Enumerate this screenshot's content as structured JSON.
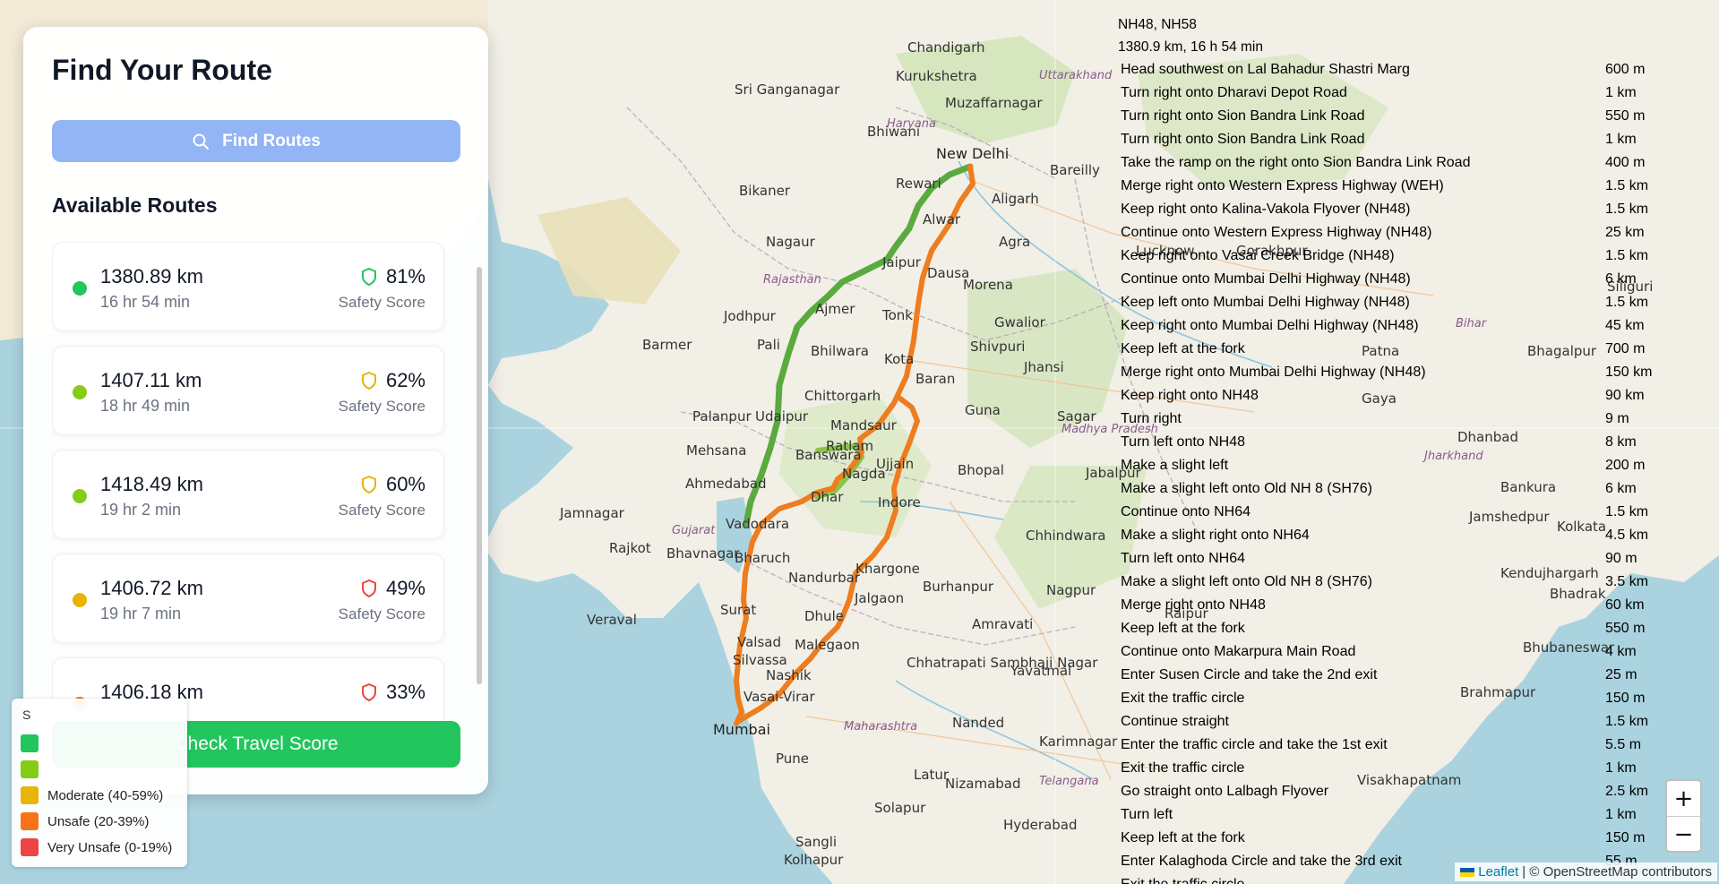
{
  "panel": {
    "title": "Find Your Route",
    "find_button": "Find Routes",
    "routes_heading": "Available Routes",
    "check_button": "Check Travel Score",
    "routes": [
      {
        "distance": "1380.89 km",
        "time": "16 hr 54 min",
        "score": "81%",
        "score_label": "Safety Score",
        "color": "#22c55e",
        "shield_color": "#22c55e"
      },
      {
        "distance": "1407.11 km",
        "time": "18 hr 49 min",
        "score": "62%",
        "score_label": "Safety Score",
        "color": "#84cc16",
        "shield_color": "#eab308"
      },
      {
        "distance": "1418.49 km",
        "time": "19 hr 2 min",
        "score": "60%",
        "score_label": "Safety Score",
        "color": "#84cc16",
        "shield_color": "#eab308"
      },
      {
        "distance": "1406.72 km",
        "time": "19 hr 7 min",
        "score": "49%",
        "score_label": "Safety Score",
        "color": "#eab308",
        "shield_color": "#ef4444"
      },
      {
        "distance": "1406.18 km",
        "time": "",
        "score": "33%",
        "score_label": "",
        "color": "#f97316",
        "shield_color": "#ef4444"
      }
    ]
  },
  "legend": {
    "title": "S",
    "items": [
      {
        "label": "",
        "color": "#22c55e"
      },
      {
        "label": "",
        "color": "#84cc16"
      },
      {
        "label": "Moderate (40-59%)",
        "color": "#eab308"
      },
      {
        "label": "Unsafe (20-39%)",
        "color": "#f97316"
      },
      {
        "label": "Very Unsafe (0-19%)",
        "color": "#ef4444"
      }
    ]
  },
  "directions": {
    "route_name": "NH48, NH58",
    "summary": "1380.9 km, 16 h 54 min",
    "steps": [
      {
        "text": "Head southwest on Lal Bahadur Shastri Marg",
        "distance": "600 m"
      },
      {
        "text": "Turn right onto Dharavi Depot Road",
        "distance": "1 km"
      },
      {
        "text": "Turn right onto Sion Bandra Link Road",
        "distance": "550 m"
      },
      {
        "text": "Turn right onto Sion Bandra Link Road",
        "distance": "1 km"
      },
      {
        "text": "Take the ramp on the right onto Sion Bandra Link Road",
        "distance": "400 m"
      },
      {
        "text": "Merge right onto Western Express Highway (WEH)",
        "distance": "1.5 km"
      },
      {
        "text": "Keep right onto Kalina-Vakola Flyover (NH48)",
        "distance": "1.5 km"
      },
      {
        "text": "Continue onto Western Express Highway (NH48)",
        "distance": "25 km"
      },
      {
        "text": "Keep right onto Vasai Creek Bridge (NH48)",
        "distance": "1.5 km"
      },
      {
        "text": "Continue onto Mumbai Delhi Highway (NH48)",
        "distance": "6 km"
      },
      {
        "text": "Keep left onto Mumbai Delhi Highway (NH48)",
        "distance": "1.5 km"
      },
      {
        "text": "Keep right onto Mumbai Delhi Highway (NH48)",
        "distance": "45 km"
      },
      {
        "text": "Keep left at the fork",
        "distance": "700 m"
      },
      {
        "text": "Merge right onto Mumbai Delhi Highway (NH48)",
        "distance": "150 km"
      },
      {
        "text": "Keep right onto NH48",
        "distance": "90 km"
      },
      {
        "text": "Turn right",
        "distance": "9 m"
      },
      {
        "text": "Turn left onto NH48",
        "distance": "8 km"
      },
      {
        "text": "Make a slight left",
        "distance": "200 m"
      },
      {
        "text": "Make a slight left onto Old NH 8 (SH76)",
        "distance": "6 km"
      },
      {
        "text": "Continue onto NH64",
        "distance": "1.5 km"
      },
      {
        "text": "Make a slight right onto NH64",
        "distance": "4.5 km"
      },
      {
        "text": "Turn left onto NH64",
        "distance": "90 m"
      },
      {
        "text": "Make a slight left onto Old NH 8 (SH76)",
        "distance": "3.5 km"
      },
      {
        "text": "Merge right onto NH48",
        "distance": "60 km"
      },
      {
        "text": "Keep left at the fork",
        "distance": "550 m"
      },
      {
        "text": "Continue onto Makarpura Main Road",
        "distance": "4 km"
      },
      {
        "text": "Enter Susen Circle and take the 2nd exit",
        "distance": "25 m"
      },
      {
        "text": "Exit the traffic circle",
        "distance": "150 m"
      },
      {
        "text": "Continue straight",
        "distance": "1.5 km"
      },
      {
        "text": "Enter the traffic circle and take the 1st exit",
        "distance": "5.5 m"
      },
      {
        "text": "Exit the traffic circle",
        "distance": "1 km"
      },
      {
        "text": "Go straight onto Lalbagh Flyover",
        "distance": "2.5 km"
      },
      {
        "text": "Turn left",
        "distance": "1 km"
      },
      {
        "text": "Keep left at the fork",
        "distance": "150 m"
      },
      {
        "text": "Enter Kalaghoda Circle and take the 3rd exit",
        "distance": "55 m"
      },
      {
        "text": "Exit the traffic circle",
        "distance": ""
      }
    ]
  },
  "map": {
    "cities": [
      "New Delhi",
      "Chandigarh",
      "Kurukshetra",
      "Muzaffarnagar",
      "Bareilly",
      "Aligarh",
      "Agra",
      "Jaipur",
      "Ajmer",
      "Jodhpur",
      "Bikaner",
      "Nagaur",
      "Barmer",
      "Pali",
      "Udaipur",
      "Bhilwara",
      "Chittorgarh",
      "Kota",
      "Gwalior",
      "Jhansi",
      "Morena",
      "Shivpuri",
      "Guna",
      "Bhopal",
      "Indore",
      "Ujjain",
      "Ratlam",
      "Banswara",
      "Mandsaur",
      "Ahmedabad",
      "Vadodara",
      "Surat",
      "Jamnagar",
      "Rajkot",
      "Bhavnagar",
      "Mehsana",
      "Palanpur",
      "Dhule",
      "Jalgaon",
      "Nashik",
      "Malegaon",
      "Mumbai",
      "Vasai-Virar",
      "Pune",
      "Solapur",
      "Nanded",
      "Amravati",
      "Nagpur",
      "Jabalpur",
      "Chhatrapati Sambhaji Nagar",
      "Hyderabad",
      "Kolhapur",
      "Lucknow",
      "Patna",
      "Gorakhpur",
      "Gaya",
      "Dhanbad",
      "Kolkata",
      "Jamshedpur",
      "Siliguri",
      "Bhagalpur",
      "Bhubaneswar",
      "Raipur",
      "Sri Ganganagar",
      "Bhiwani",
      "Rewari",
      "Alwar",
      "Tonk",
      "Dausa",
      "Baran",
      "Nagda",
      "Khargone",
      "Burhanpur",
      "Yavatmal",
      "Veraval",
      "Chhindwara",
      "Sagar",
      "Dhar",
      "Bharuch",
      "Valsad",
      "Silvassa",
      "Nandurbar",
      "Sangli",
      "Latur",
      "Visakhapatnam",
      "Brahmapur",
      "Bhadrak",
      "Kendujhargarh",
      "Bankura",
      "Karimnagar",
      "Nizamabad"
    ],
    "regions": [
      "Rajasthan",
      "Haryana",
      "Uttarakhand",
      "Gujarat",
      "Madhya Pradesh",
      "Maharashtra",
      "Jharkhand",
      "Bihar",
      "Telangana"
    ],
    "route_colors": {
      "green": "#5aaa3f",
      "lime": "#8bc34a",
      "orange": "#ee7d1f"
    }
  },
  "attribution": {
    "leaflet": "Leaflet",
    "text": "| © OpenStreetMap contributors"
  },
  "zoom": {
    "in": "+",
    "out": "−"
  }
}
